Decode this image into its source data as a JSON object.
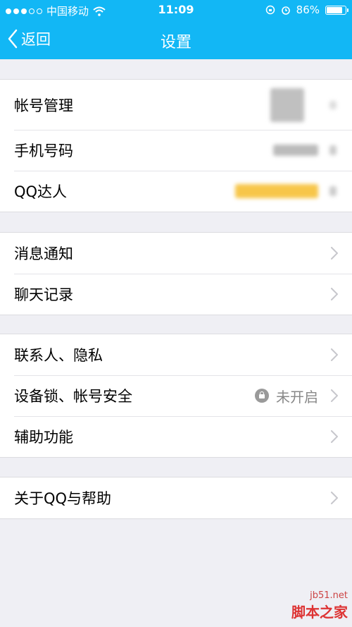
{
  "status_bar": {
    "carrier": "中国移动",
    "time": "11:09",
    "battery": "86%",
    "battery_level": 0.86
  },
  "nav": {
    "back_label": "返回",
    "title": "设置"
  },
  "sections": [
    {
      "rows": [
        {
          "label": "帐号管理"
        },
        {
          "label": "手机号码"
        },
        {
          "label": "QQ达人"
        }
      ]
    },
    {
      "rows": [
        {
          "label": "消息通知"
        },
        {
          "label": "聊天记录"
        }
      ]
    },
    {
      "rows": [
        {
          "label": "联系人、隐私"
        },
        {
          "label": "设备锁、帐号安全",
          "value": "未开启"
        },
        {
          "label": "辅助功能"
        }
      ]
    },
    {
      "rows": [
        {
          "label": "关于QQ与帮助"
        }
      ]
    }
  ],
  "watermark": {
    "site": "jb51.net",
    "brand": "脚本之家"
  },
  "colors": {
    "nav_bg": "#12b7f5",
    "page_bg": "#efeff4",
    "chevron": "#c7c7cc"
  }
}
